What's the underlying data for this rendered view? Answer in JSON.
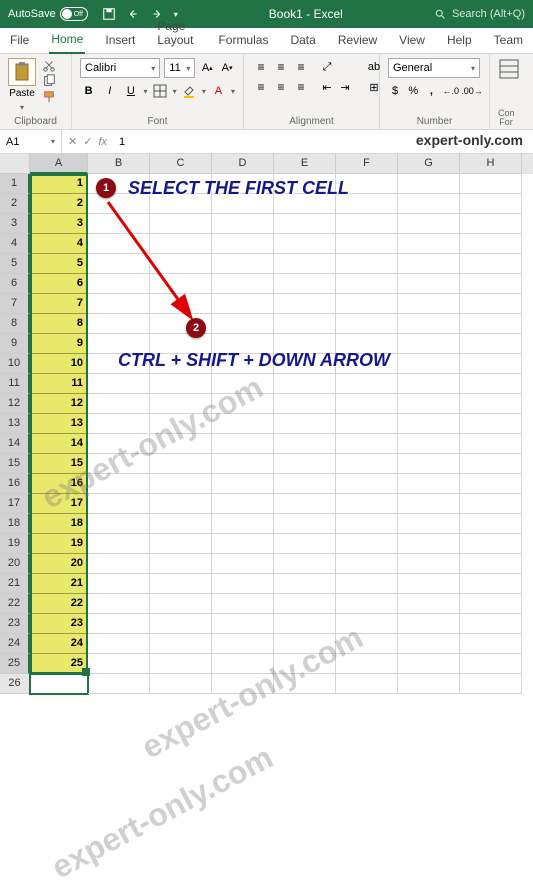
{
  "titlebar": {
    "autosave_label": "AutoSave",
    "autosave_state": "Off",
    "title": "Book1 - Excel",
    "search_placeholder": "Search (Alt+Q)"
  },
  "tabs": {
    "file": "File",
    "home": "Home",
    "insert": "Insert",
    "pagelayout": "Page Layout",
    "formulas": "Formulas",
    "data": "Data",
    "review": "Review",
    "view": "View",
    "help": "Help",
    "team": "Team"
  },
  "ribbon": {
    "clipboard": {
      "label": "Clipboard",
      "paste": "Paste"
    },
    "font": {
      "label": "Font",
      "name": "Calibri",
      "size": "11",
      "bold": "B",
      "italic": "I",
      "underline": "U"
    },
    "alignment": {
      "label": "Alignment"
    },
    "number": {
      "label": "Number",
      "format": "General",
      "currency": "$",
      "percent": "%",
      "comma": ",",
      "inc": ".0",
      "dec": ".00"
    },
    "cond": {
      "label": "Con\nFor"
    }
  },
  "namebar": {
    "cell_ref": "A1",
    "fx": "fx",
    "formula": "1"
  },
  "columns": [
    "A",
    "B",
    "C",
    "D",
    "E",
    "F",
    "G",
    "H"
  ],
  "rows": [
    {
      "n": "1",
      "v": "1"
    },
    {
      "n": "2",
      "v": "2"
    },
    {
      "n": "3",
      "v": "3"
    },
    {
      "n": "4",
      "v": "4"
    },
    {
      "n": "5",
      "v": "5"
    },
    {
      "n": "6",
      "v": "6"
    },
    {
      "n": "7",
      "v": "7"
    },
    {
      "n": "8",
      "v": "8"
    },
    {
      "n": "9",
      "v": "9"
    },
    {
      "n": "10",
      "v": "10"
    },
    {
      "n": "11",
      "v": "11"
    },
    {
      "n": "12",
      "v": "12"
    },
    {
      "n": "13",
      "v": "13"
    },
    {
      "n": "14",
      "v": "14"
    },
    {
      "n": "15",
      "v": "15"
    },
    {
      "n": "16",
      "v": "16"
    },
    {
      "n": "17",
      "v": "17"
    },
    {
      "n": "18",
      "v": "18"
    },
    {
      "n": "19",
      "v": "19"
    },
    {
      "n": "20",
      "v": "20"
    },
    {
      "n": "21",
      "v": "21"
    },
    {
      "n": "22",
      "v": "22"
    },
    {
      "n": "23",
      "v": "23"
    },
    {
      "n": "24",
      "v": "24"
    },
    {
      "n": "25",
      "v": "25"
    },
    {
      "n": "26",
      "v": ""
    }
  ],
  "annotations": {
    "step1_num": "1",
    "step1_text": "SELECT THE FIRST CELL",
    "step2_num": "2",
    "step2_text": "CTRL + SHIFT + DOWN ARROW"
  },
  "watermark": {
    "top": "expert-only.com",
    "diag": "expert-only.com"
  }
}
